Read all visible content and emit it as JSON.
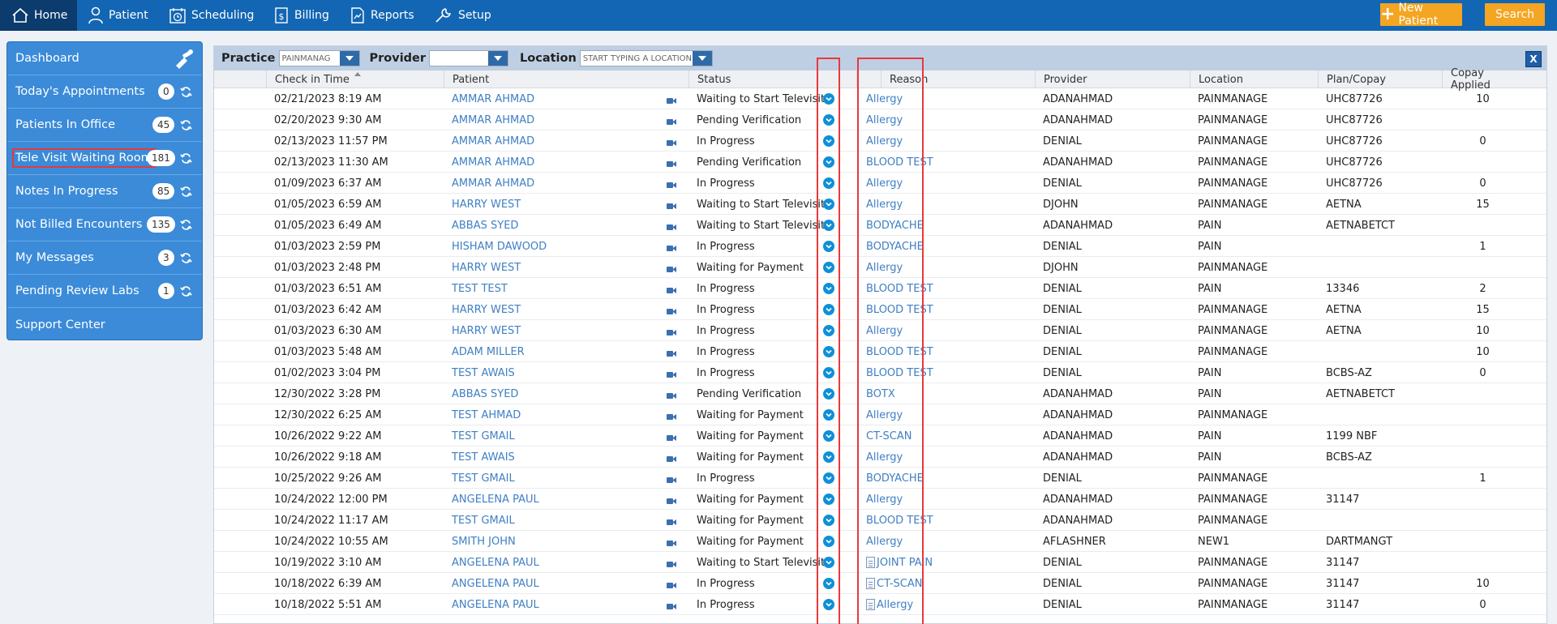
{
  "nav": {
    "items": [
      {
        "label": "Home",
        "icon": "house-icon"
      },
      {
        "label": "Patient",
        "icon": "person-icon"
      },
      {
        "label": "Scheduling",
        "icon": "calendar-clock-icon"
      },
      {
        "label": "Billing",
        "icon": "dollar-document-icon"
      },
      {
        "label": "Reports",
        "icon": "chart-document-icon"
      },
      {
        "label": "Setup",
        "icon": "wrench-icon"
      }
    ],
    "new_patient_label": "New Patient",
    "search_label": "Search",
    "accent_color": "#f4a521",
    "bar_color": "#1366b3"
  },
  "sidebar": {
    "dashboard_label": "Dashboard",
    "items": [
      {
        "label": "Today's Appointments",
        "count": "0"
      },
      {
        "label": "Patients In Office",
        "count": "45"
      },
      {
        "label": "Tele Visit Waiting Room",
        "count": "181"
      },
      {
        "label": "Notes In Progress",
        "count": "85"
      },
      {
        "label": "Not Billed Encounters",
        "count": "135"
      },
      {
        "label": "My Messages",
        "count": "3"
      },
      {
        "label": "Pending Review Labs",
        "count": "1"
      }
    ],
    "support_label": "Support Center"
  },
  "filters": {
    "practice_label": "Practice",
    "practice_value": "PAINMANAG",
    "provider_label": "Provider",
    "provider_value": "",
    "location_label": "Location",
    "location_placeholder": "START TYPING A LOCATION"
  },
  "table": {
    "columns": [
      "Check in Time",
      "Patient",
      "Status",
      "Reason",
      "Provider",
      "Location",
      "Plan/Copay",
      "Copay Applied"
    ],
    "rows": [
      {
        "time": "02/21/2023 8:19 AM",
        "patient": "AMMAR AHMAD",
        "status": "Waiting to Start Televisit",
        "reason": "Allergy",
        "provider": "ADANAHMAD",
        "location": "PAINMANAGE",
        "plan": "UHC87726",
        "copay": "10",
        "doc": false
      },
      {
        "time": "02/20/2023 9:30 AM",
        "patient": "AMMAR AHMAD",
        "status": "Pending Verification",
        "reason": "Allergy",
        "provider": "ADANAHMAD",
        "location": "PAINMANAGE",
        "plan": "UHC87726",
        "copay": "",
        "doc": false
      },
      {
        "time": "02/13/2023 11:57 PM",
        "patient": "AMMAR AHMAD",
        "status": "In Progress",
        "reason": "Allergy",
        "provider": "DENIAL",
        "location": "PAINMANAGE",
        "plan": "UHC87726",
        "copay": "0",
        "doc": false
      },
      {
        "time": "02/13/2023 11:30 AM",
        "patient": "AMMAR AHMAD",
        "status": "Pending Verification",
        "reason": "BLOOD TEST",
        "provider": "ADANAHMAD",
        "location": "PAINMANAGE",
        "plan": "UHC87726",
        "copay": "",
        "doc": false
      },
      {
        "time": "01/09/2023 6:37 AM",
        "patient": "AMMAR AHMAD",
        "status": "In Progress",
        "reason": "Allergy",
        "provider": "DENIAL",
        "location": "PAINMANAGE",
        "plan": "UHC87726",
        "copay": "0",
        "doc": false
      },
      {
        "time": "01/05/2023 6:59 AM",
        "patient": "HARRY WEST",
        "status": "Waiting to Start Televisit",
        "reason": "Allergy",
        "provider": "DJOHN",
        "location": "PAINMANAGE",
        "plan": "AETNA",
        "copay": "15",
        "doc": false
      },
      {
        "time": "01/05/2023 6:49 AM",
        "patient": "ABBAS SYED",
        "status": "Waiting to Start Televisit",
        "reason": "BODYACHE",
        "provider": "ADANAHMAD",
        "location": "PAIN",
        "plan": "AETNABETCT",
        "copay": "",
        "doc": false
      },
      {
        "time": "01/03/2023 2:59 PM",
        "patient": "HISHAM DAWOOD",
        "status": "In Progress",
        "reason": "BODYACHE",
        "provider": "DENIAL",
        "location": "PAIN",
        "plan": "",
        "copay": "1",
        "doc": false
      },
      {
        "time": "01/03/2023 2:48 PM",
        "patient": "HARRY WEST",
        "status": "Waiting for Payment",
        "reason": "Allergy",
        "provider": "DJOHN",
        "location": "PAINMANAGE",
        "plan": "",
        "copay": "",
        "doc": false
      },
      {
        "time": "01/03/2023 6:51 AM",
        "patient": "TEST TEST",
        "status": "In Progress",
        "reason": "BLOOD TEST",
        "provider": "DENIAL",
        "location": "PAIN",
        "plan": "13346",
        "copay": "2",
        "doc": false
      },
      {
        "time": "01/03/2023 6:42 AM",
        "patient": "HARRY WEST",
        "status": "In Progress",
        "reason": "BLOOD TEST",
        "provider": "DENIAL",
        "location": "PAINMANAGE",
        "plan": "AETNA",
        "copay": "15",
        "doc": false
      },
      {
        "time": "01/03/2023 6:30 AM",
        "patient": "HARRY WEST",
        "status": "In Progress",
        "reason": "Allergy",
        "provider": "DENIAL",
        "location": "PAINMANAGE",
        "plan": "AETNA",
        "copay": "10",
        "doc": false
      },
      {
        "time": "01/03/2023 5:48 AM",
        "patient": "ADAM MILLER",
        "status": "In Progress",
        "reason": "BLOOD TEST",
        "provider": "DENIAL",
        "location": "PAINMANAGE",
        "plan": "",
        "copay": "10",
        "doc": false
      },
      {
        "time": "01/02/2023 3:04 PM",
        "patient": "TEST AWAIS",
        "status": "In Progress",
        "reason": "BLOOD TEST",
        "provider": "DENIAL",
        "location": "PAIN",
        "plan": "BCBS-AZ",
        "copay": "0",
        "doc": false
      },
      {
        "time": "12/30/2022 3:28 PM",
        "patient": "ABBAS SYED",
        "status": "Pending Verification",
        "reason": "BOTX",
        "provider": "ADANAHMAD",
        "location": "PAIN",
        "plan": "AETNABETCT",
        "copay": "",
        "doc": false
      },
      {
        "time": "12/30/2022 6:25 AM",
        "patient": "TEST AHMAD",
        "status": "Waiting for Payment",
        "reason": "Allergy",
        "provider": "ADANAHMAD",
        "location": "PAINMANAGE",
        "plan": "",
        "copay": "",
        "doc": false
      },
      {
        "time": "10/26/2022 9:22 AM",
        "patient": "TEST GMAIL",
        "status": "Waiting for Payment",
        "reason": "CT-SCAN",
        "provider": "ADANAHMAD",
        "location": "PAIN",
        "plan": "1199 NBF",
        "copay": "",
        "doc": false
      },
      {
        "time": "10/26/2022 9:18 AM",
        "patient": "TEST AWAIS",
        "status": "Waiting for Payment",
        "reason": "Allergy",
        "provider": "ADANAHMAD",
        "location": "PAIN",
        "plan": "BCBS-AZ",
        "copay": "",
        "doc": false
      },
      {
        "time": "10/25/2022 9:26 AM",
        "patient": "TEST GMAIL",
        "status": "In Progress",
        "reason": "BODYACHE",
        "provider": "DENIAL",
        "location": "PAINMANAGE",
        "plan": "",
        "copay": "1",
        "doc": false
      },
      {
        "time": "10/24/2022 12:00 PM",
        "patient": "ANGELENA PAUL",
        "status": "Waiting for Payment",
        "reason": "Allergy",
        "provider": "ADANAHMAD",
        "location": "PAINMANAGE",
        "plan": "31147",
        "copay": "",
        "doc": false
      },
      {
        "time": "10/24/2022 11:17 AM",
        "patient": "TEST GMAIL",
        "status": "Waiting for Payment",
        "reason": "BLOOD TEST",
        "provider": "ADANAHMAD",
        "location": "PAINMANAGE",
        "plan": "",
        "copay": "",
        "doc": false
      },
      {
        "time": "10/24/2022 10:55 AM",
        "patient": "SMITH JOHN",
        "status": "Waiting for Payment",
        "reason": "Allergy",
        "provider": "AFLASHNER",
        "location": "NEW1",
        "plan": "DARTMANGT",
        "copay": "",
        "doc": false
      },
      {
        "time": "10/19/2022 3:10 AM",
        "patient": "ANGELENA PAUL",
        "status": "Waiting to Start Televisit",
        "reason": "JOINT PAIN",
        "provider": "DENIAL",
        "location": "PAINMANAGE",
        "plan": "31147",
        "copay": "",
        "doc": true
      },
      {
        "time": "10/18/2022 6:39 AM",
        "patient": "ANGELENA PAUL",
        "status": "In Progress",
        "reason": "CT-SCAN",
        "provider": "DENIAL",
        "location": "PAINMANAGE",
        "plan": "31147",
        "copay": "10",
        "doc": true
      },
      {
        "time": "10/18/2022 5:51 AM",
        "patient": "ANGELENA PAUL",
        "status": "In Progress",
        "reason": "Allergy",
        "provider": "DENIAL",
        "location": "PAINMANAGE",
        "plan": "31147",
        "copay": "0",
        "doc": true
      }
    ]
  }
}
